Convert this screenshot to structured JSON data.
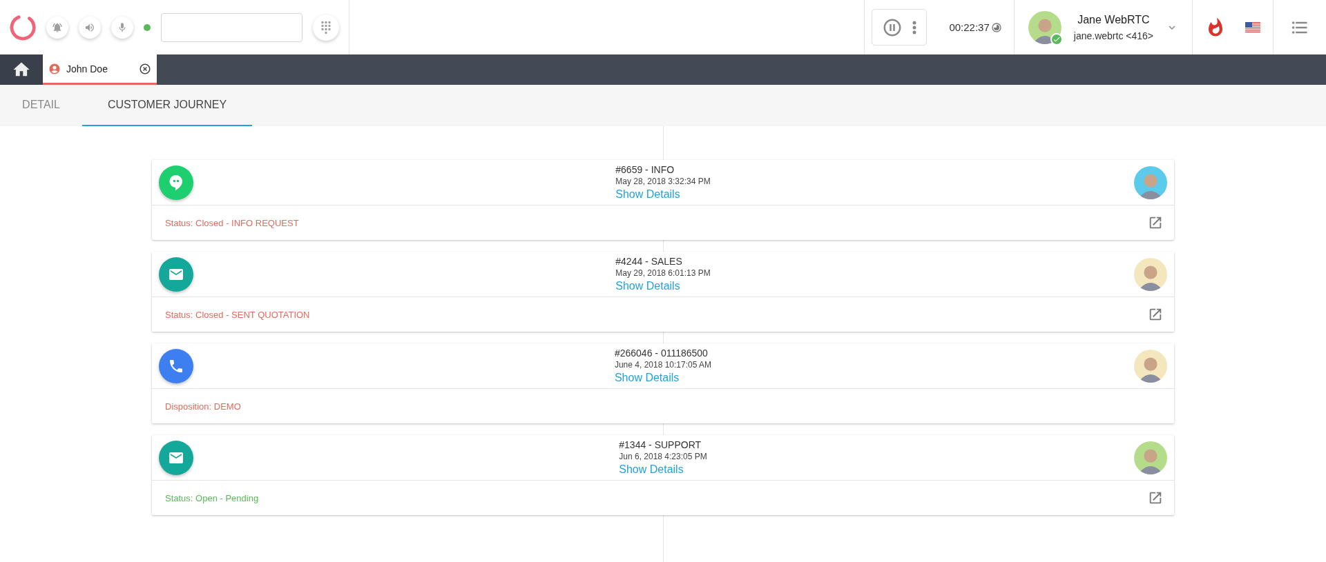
{
  "toolbar": {
    "status": {
      "color": "#5cb85c"
    },
    "timer": "00:22:37",
    "user": {
      "name": "Jane WebRTC",
      "extension": "jane.webrtc <416>",
      "avatar": {
        "color": "#b5dc8a"
      },
      "online": true
    }
  },
  "open_tabs": [
    {
      "label": "John Doe",
      "selected": true
    }
  ],
  "tabs": [
    {
      "label": "DETAIL",
      "selected": false
    },
    {
      "label": "CUSTOMER JOURNEY",
      "selected": true
    }
  ],
  "journey": [
    {
      "kind": "chat",
      "color": "#1ecf6f",
      "title": "#6659 - INFO",
      "date": "May 28, 2018 3:32:34 PM",
      "link": "Show Details",
      "avatar": {
        "color": "#5ccbeb"
      },
      "status": {
        "text": "Status: Closed - INFO REQUEST",
        "color": "#e5685c"
      },
      "external": true
    },
    {
      "kind": "email",
      "color": "#14a89a",
      "title": "#4244 - SALES",
      "date": "May 29, 2018 6:01:13 PM",
      "link": "Show Details",
      "avatar": {
        "color": "#f5e7bd"
      },
      "status": {
        "text": "Status: Closed - SENT QUOTATION",
        "color": "#e5685c"
      },
      "external": true
    },
    {
      "kind": "phone",
      "color": "#3d7ef0",
      "title": "#266046 - 011186500",
      "date": "June 4, 2018 10:17:05 AM",
      "link": "Show Details",
      "avatar": {
        "color": "#f5e7bd"
      },
      "status": {
        "text": "Disposition: DEMO",
        "color": "#e5685c"
      },
      "external": false
    },
    {
      "kind": "email",
      "color": "#14a89a",
      "title": "#1344 - SUPPORT",
      "date": "Jun 6, 2018 4:23:05 PM",
      "link": "Show Details",
      "avatar": {
        "color": "#b5dc8a"
      },
      "status": {
        "text": "Status: Open - Pending",
        "color": "#5cb85c"
      },
      "external": true
    }
  ]
}
